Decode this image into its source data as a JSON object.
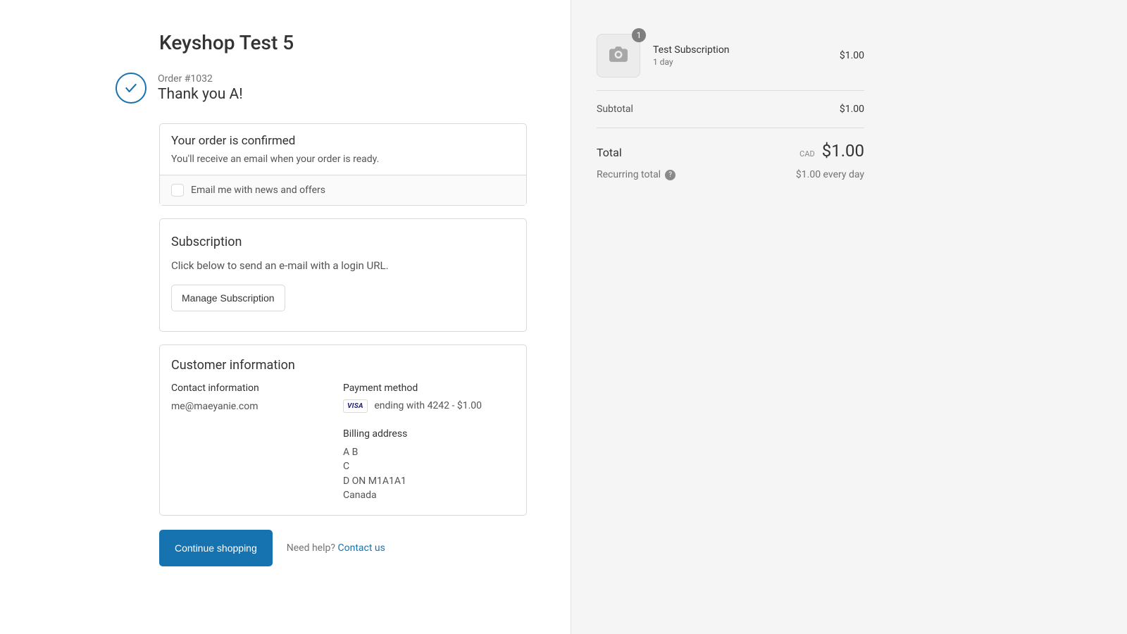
{
  "shop": {
    "name": "Keyshop Test 5"
  },
  "order": {
    "number_label": "Order #1032",
    "thank_you": "Thank you A!"
  },
  "confirm": {
    "title": "Your order is confirmed",
    "subtitle": "You'll receive an email when your order is ready.",
    "newsletter_label": "Email me with news and offers"
  },
  "subscription": {
    "title": "Subscription",
    "subtitle": "Click below to send an e-mail with a login URL.",
    "manage_label": "Manage Subscription"
  },
  "customer": {
    "title": "Customer information",
    "contact_label": "Contact information",
    "contact_email": "me@maeyanie.com",
    "payment_label": "Payment method",
    "card_brand": "VISA",
    "card_text": "ending with 4242 - $1.00",
    "billing_label": "Billing address",
    "billing_line1": "A B",
    "billing_line2": "C",
    "billing_line3": "D ON M1A1A1",
    "billing_line4": "Canada"
  },
  "actions": {
    "continue_label": "Continue shopping",
    "help_label": "Need help?",
    "contact_label": "Contact us"
  },
  "summary": {
    "item": {
      "name": "Test Subscription",
      "subtitle": "1 day",
      "qty": "1",
      "price": "$1.00"
    },
    "subtotal_label": "Subtotal",
    "subtotal_value": "$1.00",
    "total_label": "Total",
    "currency_code": "CAD",
    "total_value": "$1.00",
    "recurring_label": "Recurring total",
    "recurring_value": "$1.00 every day"
  }
}
